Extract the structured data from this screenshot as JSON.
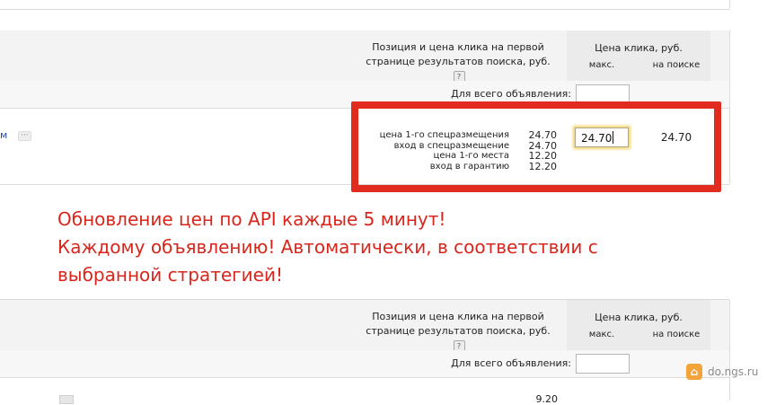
{
  "header": {
    "position_line1": "Позиция и цена клика на первой",
    "position_line2": "странице результатов поиска, руб.",
    "help": "?",
    "price_title": "Цена клика, руб.",
    "col_max": "макс.",
    "col_search": "на поиске"
  },
  "all_ads_label": "Для всего объявления:",
  "ad_row": {
    "link_text": "м",
    "more": "···",
    "metrics": [
      {
        "label": "цена 1-го спецразмещения",
        "value": "24.70"
      },
      {
        "label": "вход в спецразмещение",
        "value": "24.70"
      },
      {
        "label": "цена 1-го места",
        "value": "12.20"
      },
      {
        "label": "вход в гарантию",
        "value": "12.20"
      }
    ],
    "bid_value": "24.70",
    "search_price": "24.70"
  },
  "promo": {
    "line1": "Обновление цен по API каждые 5 минут!",
    "line2": "Каждому объявлению! Автоматически, в соответствии с",
    "line3": "выбранной стратегией!"
  },
  "second_block": {
    "partial_value": "9.20"
  },
  "watermark": {
    "icon": "ngs-logo-icon",
    "text": "do.ngs.ru"
  },
  "colors": {
    "accent_red": "#e02b1e",
    "promo_text": "#d9261c",
    "panel_bg": "#f3f3f3",
    "focus_glow": "#f1d46a"
  }
}
